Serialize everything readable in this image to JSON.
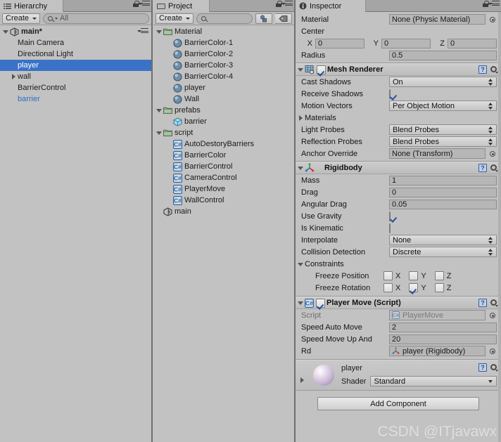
{
  "hierarchy": {
    "tab_label": "Hierarchy",
    "tab_icon": "hierarchy-icon",
    "create_label": "Create",
    "search_placeholder": "All",
    "root": {
      "label": "main*",
      "icon": "unity-scene-icon"
    },
    "items": [
      {
        "label": "Main Camera",
        "indent": 1,
        "arrow": "none",
        "selected": false,
        "prefab": false
      },
      {
        "label": "Directional Light",
        "indent": 1,
        "arrow": "none",
        "selected": false,
        "prefab": false
      },
      {
        "label": "player",
        "indent": 1,
        "arrow": "none",
        "selected": true,
        "prefab": false
      },
      {
        "label": "wall",
        "indent": 1,
        "arrow": "right",
        "selected": false,
        "prefab": false
      },
      {
        "label": "BarrierControl",
        "indent": 1,
        "arrow": "none",
        "selected": false,
        "prefab": false
      },
      {
        "label": "barrier",
        "indent": 1,
        "arrow": "none",
        "selected": false,
        "prefab": true
      }
    ]
  },
  "project": {
    "tab_label": "Project",
    "tab_icon": "project-folder-icon",
    "create_label": "Create",
    "search_placeholder": "",
    "filter_type_icon": "filter-by-type-icon",
    "filter_label_icon": "filter-by-label-icon",
    "items": [
      {
        "label": "Material",
        "indent": 0,
        "arrow": "down",
        "icon": "folder-icon"
      },
      {
        "label": "BarrierColor-1",
        "indent": 1,
        "arrow": "none",
        "icon": "material-icon"
      },
      {
        "label": "BarrierColor-2",
        "indent": 1,
        "arrow": "none",
        "icon": "material-icon"
      },
      {
        "label": "BarrierColor-3",
        "indent": 1,
        "arrow": "none",
        "icon": "material-icon"
      },
      {
        "label": "BarrierColor-4",
        "indent": 1,
        "arrow": "none",
        "icon": "material-icon"
      },
      {
        "label": "player",
        "indent": 1,
        "arrow": "none",
        "icon": "material-icon"
      },
      {
        "label": "Wall",
        "indent": 1,
        "arrow": "none",
        "icon": "material-icon"
      },
      {
        "label": "prefabs",
        "indent": 0,
        "arrow": "down",
        "icon": "folder-icon"
      },
      {
        "label": "barrier",
        "indent": 1,
        "arrow": "none",
        "icon": "prefab-cube-icon"
      },
      {
        "label": "script",
        "indent": 0,
        "arrow": "down",
        "icon": "folder-icon"
      },
      {
        "label": "AutoDestoryBarriers",
        "indent": 1,
        "arrow": "none",
        "icon": "csharp-script-icon"
      },
      {
        "label": "BarrierColor",
        "indent": 1,
        "arrow": "none",
        "icon": "csharp-script-icon"
      },
      {
        "label": "BarrierControl",
        "indent": 1,
        "arrow": "none",
        "icon": "csharp-script-icon"
      },
      {
        "label": "CameraControl",
        "indent": 1,
        "arrow": "none",
        "icon": "csharp-script-icon"
      },
      {
        "label": "PlayerMove",
        "indent": 1,
        "arrow": "none",
        "icon": "csharp-script-icon"
      },
      {
        "label": "WallControl",
        "indent": 1,
        "arrow": "none",
        "icon": "csharp-script-icon"
      },
      {
        "label": "main",
        "indent": 0,
        "arrow": "none",
        "icon": "unity-scene-icon"
      }
    ]
  },
  "inspector": {
    "tab_label": "Inspector",
    "tab_icon": "inspector-icon",
    "collider": {
      "material_label": "Material",
      "material_value": "None (Physic Material)",
      "center_label": "Center",
      "axes": [
        {
          "label": "X",
          "value": "0"
        },
        {
          "label": "Y",
          "value": "0"
        },
        {
          "label": "Z",
          "value": "0"
        }
      ],
      "radius_label": "Radius",
      "radius_value": "0.5"
    },
    "mesh_renderer": {
      "title": "Mesh Renderer",
      "enabled": true,
      "icon": "mesh-renderer-icon",
      "rows": [
        {
          "label": "Cast Shadows",
          "type": "popup",
          "value": "On"
        },
        {
          "label": "Receive Shadows",
          "type": "checkbox",
          "value": true
        },
        {
          "label": "Motion Vectors",
          "type": "popup",
          "value": "Per Object Motion"
        },
        {
          "label": "Materials",
          "type": "foldout",
          "value": ""
        },
        {
          "label": "Light Probes",
          "type": "popup",
          "value": "Blend Probes"
        },
        {
          "label": "Reflection Probes",
          "type": "popup",
          "value": "Blend Probes"
        },
        {
          "label": "Anchor Override",
          "type": "object",
          "value": "None (Transform)"
        }
      ]
    },
    "rigidbody": {
      "title": "Rigidbody",
      "icon": "rigidbody-icon",
      "rows": [
        {
          "label": "Mass",
          "type": "text",
          "value": "1"
        },
        {
          "label": "Drag",
          "type": "text",
          "value": "0"
        },
        {
          "label": "Angular Drag",
          "type": "text",
          "value": "0.05"
        },
        {
          "label": "Use Gravity",
          "type": "checkbox",
          "value": true
        },
        {
          "label": "Is Kinematic",
          "type": "checkbox",
          "value": false
        },
        {
          "label": "Interpolate",
          "type": "popup",
          "value": "None"
        },
        {
          "label": "Collision Detection",
          "type": "popup",
          "value": "Discrete"
        }
      ],
      "constraints_label": "Constraints",
      "freeze_position": {
        "label": "Freeze Position",
        "x": false,
        "y": false,
        "z": false
      },
      "freeze_rotation": {
        "label": "Freeze Rotation",
        "x": false,
        "y": true,
        "z": false
      }
    },
    "player_move": {
      "title": "Player Move (Script)",
      "enabled": true,
      "icon": "csharp-script-icon",
      "script_label": "Script",
      "script_value": "PlayerMove",
      "rows": [
        {
          "label": "Speed Auto Move",
          "type": "text",
          "value": "2"
        },
        {
          "label": "Speed Move Up And",
          "type": "text",
          "value": "20"
        },
        {
          "label": "Rd",
          "type": "object",
          "value": "player (Rigidbody)"
        }
      ]
    },
    "material_preview": {
      "name": "player",
      "shader_label": "Shader",
      "shader_value": "Standard"
    },
    "add_component_label": "Add Component"
  },
  "watermark": "CSDN @ITjavawx"
}
